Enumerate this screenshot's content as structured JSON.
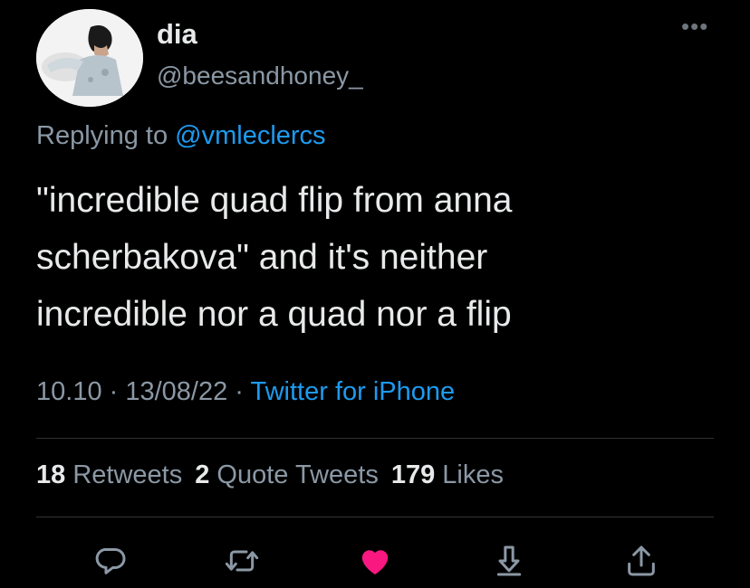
{
  "author": {
    "display_name": "dia",
    "handle": "@beesandhoney_"
  },
  "reply": {
    "prefix": "Replying to ",
    "mention": "@vmleclercs"
  },
  "tweet": {
    "text": "\"incredible quad flip from anna\nscherbakova\" and it's neither\nincredible nor a quad nor a flip"
  },
  "meta": {
    "time": "10.10",
    "separator1": " · ",
    "date": "13/08/22",
    "separator2": " · ",
    "source": "Twitter for iPhone"
  },
  "stats": {
    "retweets_count": "18",
    "retweets_label": "Retweets",
    "quotes_count": "2",
    "quotes_label": "Quote Tweets",
    "likes_count": "179",
    "likes_label": "Likes"
  },
  "icons": {
    "more": "more-icon",
    "reply": "reply-icon",
    "retweet": "retweet-icon",
    "like": "heart-icon",
    "bookmark": "bookmark-icon",
    "share": "share-icon"
  },
  "colors": {
    "background": "#000000",
    "text": "#e7e9ea",
    "secondary": "#8b98a5",
    "link": "#1d9bf0",
    "like": "#f91880",
    "divider": "#2f3336"
  }
}
